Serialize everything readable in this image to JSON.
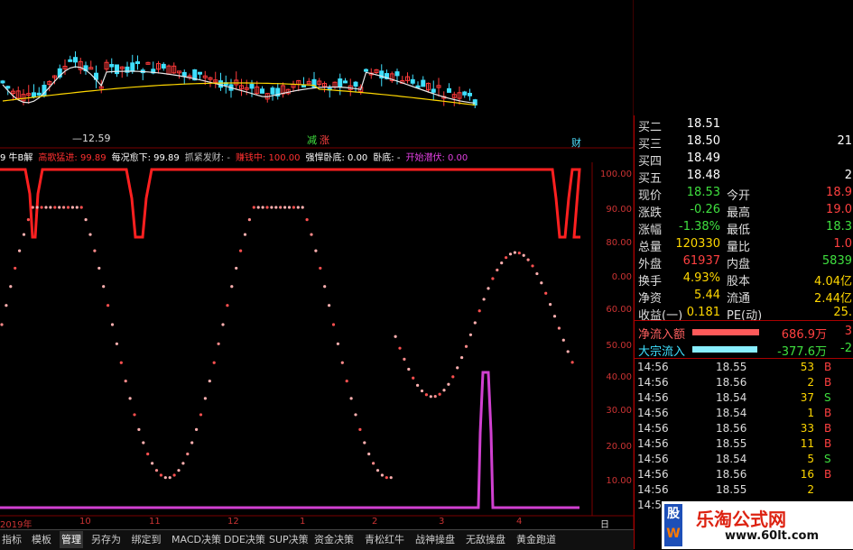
{
  "colors": {
    "up": "#ff3a3a",
    "down": "#3fe0ff",
    "ma1": "#e8e8e8",
    "ma2": "#ffd700",
    "dot_up": "#ff8a8a",
    "dot_down": "#ff5050",
    "red_line": "#ff2020",
    "magenta": "#d040d0",
    "axis": "#cc3333"
  },
  "price_chart": {
    "low_label": "—12.59",
    "marker_1": "减",
    "marker_2": "涨",
    "marker_3": "财"
  },
  "indicator": {
    "items": [
      {
        "text": "9 牛B解",
        "color": "#ffffff"
      },
      {
        "text": "高歌猛进: 99.89",
        "color": "#ff3030"
      },
      {
        "text": "每况愈下: 99.89",
        "color": "#ffffff"
      },
      {
        "text": "抓紧发财: -",
        "color": "#c0c0c0"
      },
      {
        "text": "赚钱中: 100.00",
        "color": "#ff3030"
      },
      {
        "text": "强悍卧底: 0.00",
        "color": "#ffffff"
      },
      {
        "text": "卧底: -",
        "color": "#ffffff"
      },
      {
        "text": "开始潜伏: 0.00",
        "color": "#e040e0"
      }
    ],
    "axis_upper": [
      "100.00",
      "90.00",
      "80.00",
      "0.00"
    ],
    "axis_lower": [
      "60.00",
      "50.00",
      "40.00",
      "30.00",
      "20.00",
      "10.00"
    ]
  },
  "date_axis": {
    "labels": [
      "2019年",
      "10",
      "11",
      "12",
      "1",
      "2",
      "3",
      "4"
    ],
    "period": "日线"
  },
  "quote": {
    "rows": [
      {
        "l1": "买二",
        "v1": "18.51",
        "r1": "",
        "v2": "",
        "vc": "#ffffff"
      },
      {
        "l1": "买三",
        "v1": "18.50",
        "r1": "",
        "v2": "21",
        "vc": "#ffffff"
      },
      {
        "l1": "买四",
        "v1": "18.49",
        "r1": "",
        "v2": "",
        "vc": "#ffffff"
      },
      {
        "l1": "买五",
        "v1": "18.48",
        "r1": "",
        "v2": "2",
        "vc": "#ffffff"
      },
      {
        "l1": "现价",
        "v1": "18.53",
        "r1": "今开",
        "v2": "18.9",
        "vc": "#3fe03f",
        "vc2": "#ff4040"
      },
      {
        "l1": "涨跌",
        "v1": "-0.26",
        "r1": "最高",
        "v2": "19.0",
        "vc": "#3fe03f",
        "vc2": "#ff4040"
      },
      {
        "l1": "涨幅",
        "v1": "-1.38%",
        "r1": "最低",
        "v2": "18.3",
        "vc": "#3fe03f",
        "vc2": "#3fe03f"
      },
      {
        "l1": "总量",
        "v1": "120330",
        "r1": "量比",
        "v2": "1.0",
        "vc": "#ffd700",
        "vc2": "#ff4040"
      },
      {
        "l1": "外盘",
        "v1": "61937",
        "r1": "内盘",
        "v2": "5839",
        "vc": "#ff4040",
        "vc2": "#3fe03f"
      },
      {
        "l1": "换手",
        "v1": "4.93%",
        "r1": "股本",
        "v2": "4.04亿",
        "vc": "#ffd700",
        "vc2": "#ffd700"
      },
      {
        "l1": "净资",
        "v1": "5.44",
        "r1": "流通",
        "v2": "2.44亿",
        "vc": "#ffd700",
        "vc2": "#ffd700"
      },
      {
        "l1": "收益(一)",
        "v1": "0.181",
        "r1": "PE(动)",
        "v2": "25.",
        "vc": "#ffd700",
        "vc2": "#ffd700"
      }
    ],
    "net_flow": {
      "label": "净流入额",
      "value": "686.9万",
      "extra": "3"
    },
    "block_flow": {
      "label": "大宗流入",
      "value": "-377.6万",
      "extra": "-2"
    }
  },
  "ticks": [
    {
      "t": "14:56",
      "p": "18.55",
      "v": "53",
      "d": "B"
    },
    {
      "t": "14:56",
      "p": "18.56",
      "v": "2",
      "d": "B"
    },
    {
      "t": "14:56",
      "p": "18.54",
      "v": "37",
      "d": "S"
    },
    {
      "t": "14:56",
      "p": "18.54",
      "v": "1",
      "d": "B"
    },
    {
      "t": "14:56",
      "p": "18.56",
      "v": "33",
      "d": "B"
    },
    {
      "t": "14:56",
      "p": "18.55",
      "v": "11",
      "d": "B"
    },
    {
      "t": "14:56",
      "p": "18.54",
      "v": "5",
      "d": "S"
    },
    {
      "t": "14:56",
      "p": "18.56",
      "v": "16",
      "d": "B"
    },
    {
      "t": "14:56",
      "p": "18.55",
      "v": "2",
      "d": ""
    },
    {
      "t": "14:5",
      "p": "",
      "v": "",
      "d": ""
    }
  ],
  "tabs": [
    "指标",
    "模板",
    "管理",
    "另存为",
    "绑定到",
    "MACD决策",
    "DDE决策",
    "SUP决策",
    "资金决策",
    "青松红牛",
    "战神操盘",
    "无敌操盘",
    "黄金跑道"
  ],
  "active_tab": 2,
  "watermark": {
    "brand": "股",
    "brand2": "W",
    "site": "乐淘公式网",
    "url": "www.60lt.com"
  }
}
